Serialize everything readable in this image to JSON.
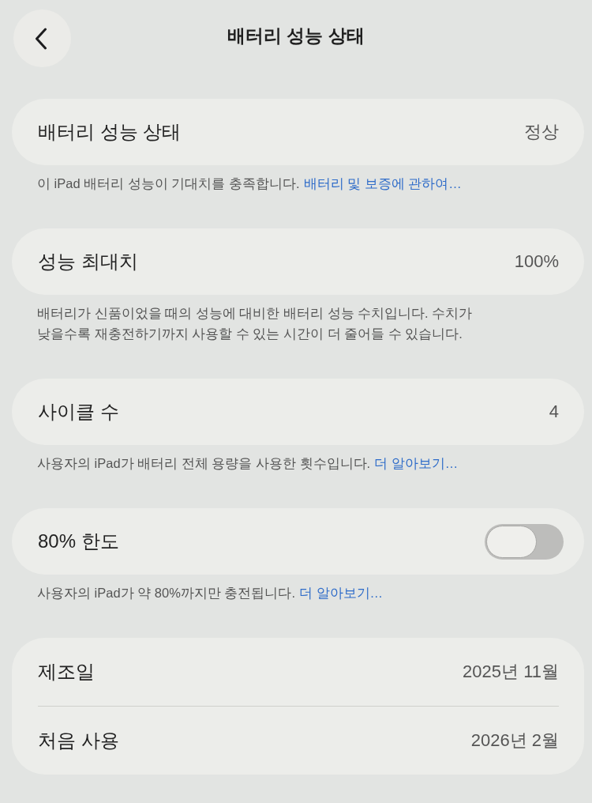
{
  "nav": {
    "title": "배터리 성능 상태"
  },
  "groups": [
    {
      "rows": [
        {
          "kind": "value",
          "label": "배터리 성능 상태",
          "value": "정상"
        }
      ],
      "footer": {
        "text": "이 iPad 배터리 성능이 기대치를 충족합니다.",
        "link": "배터리 및 보증에 관하여…"
      }
    },
    {
      "rows": [
        {
          "kind": "value",
          "label": "성능 최대치",
          "value": "100%"
        }
      ],
      "footer": {
        "text": "배터리가 신품이었을 때의 성능에 대비한 배터리 성능 수치입니다. 수치가 낮을수록 재충전하기까지 사용할 수 있는 시간이 더 줄어들 수 있습니다."
      }
    },
    {
      "rows": [
        {
          "kind": "value",
          "label": "사이클 수",
          "value": "4"
        }
      ],
      "footer": {
        "text": "사용자의 iPad가 배터리 전체 용량을 사용한 횟수입니다.",
        "link": "더 알아보기…"
      }
    },
    {
      "rows": [
        {
          "kind": "toggle",
          "label": "80% 한도",
          "on": false
        }
      ],
      "footer": {
        "text": "사용자의 iPad가 약 80%까지만 충전됩니다.",
        "link": "더 알아보기…"
      }
    },
    {
      "rows": [
        {
          "kind": "value",
          "label": "제조일",
          "value": "2025년 11월"
        },
        {
          "kind": "value",
          "label": "처음 사용",
          "value": "2026년 2월"
        }
      ]
    }
  ]
}
